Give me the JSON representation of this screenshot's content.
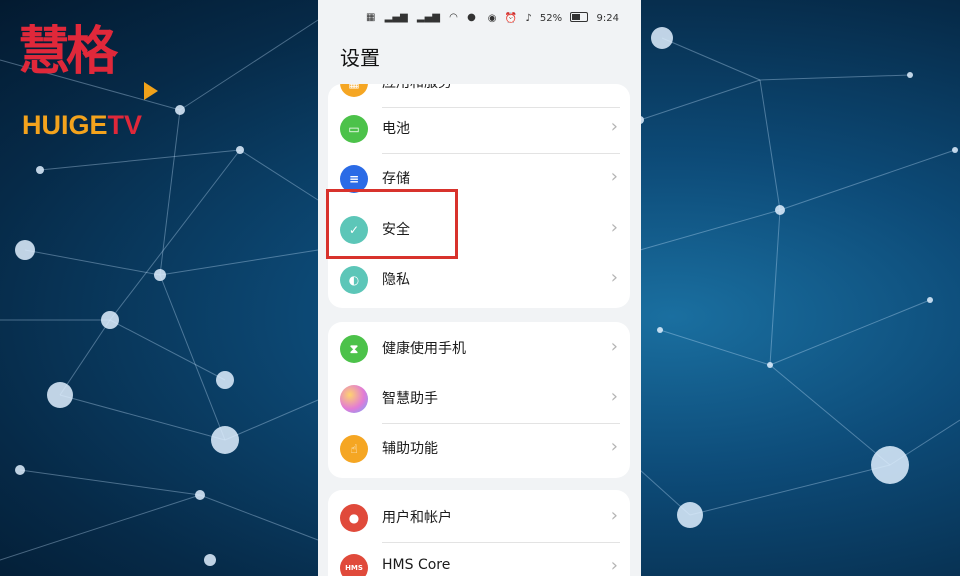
{
  "watermark": {
    "glyphs": "慧格",
    "text_part1": "HUIGE",
    "text_part2": "TV",
    "colors": {
      "red": "#e0283a",
      "orange": "#f3a31d"
    }
  },
  "status_bar": {
    "left_icons": [
      "sim-card-icon",
      "signal-icon",
      "signal-icon",
      "wifi-icon",
      "data-rate",
      "wechat-icon"
    ],
    "right_icons": [
      "eye-icon",
      "alarm-icon",
      "mute-icon"
    ],
    "battery_percent": "52%",
    "time": "9:24"
  },
  "header": {
    "title": "设置"
  },
  "groups": [
    {
      "items": [
        {
          "label": "应用和服务",
          "icon": "apps-icon",
          "color": "#f5a623"
        },
        {
          "label": "电池",
          "icon": "battery-icon",
          "color": "#4cc24a"
        },
        {
          "label": "存储",
          "icon": "storage-icon",
          "color": "#2b6be6"
        },
        {
          "label": "安全",
          "icon": "shield-icon",
          "color": "#5cc6b8"
        },
        {
          "label": "隐私",
          "icon": "privacy-icon",
          "color": "#5cc6b8"
        }
      ]
    },
    {
      "items": [
        {
          "label": "健康使用手机",
          "icon": "hourglass-icon",
          "color": "#4cc24a"
        },
        {
          "label": "智慧助手",
          "icon": "assistant-icon",
          "color": "#c06ee0"
        },
        {
          "label": "辅助功能",
          "icon": "accessibility-icon",
          "color": "#f5a623"
        }
      ]
    },
    {
      "items": [
        {
          "label": "用户和帐户",
          "icon": "user-icon",
          "color": "#e04a3b"
        },
        {
          "label": "HMS Core",
          "icon": "hms-icon",
          "color": "#e04a3b",
          "icon_text": "HMS"
        }
      ]
    }
  ],
  "chevron": "›",
  "highlight_color": "#d8322c"
}
